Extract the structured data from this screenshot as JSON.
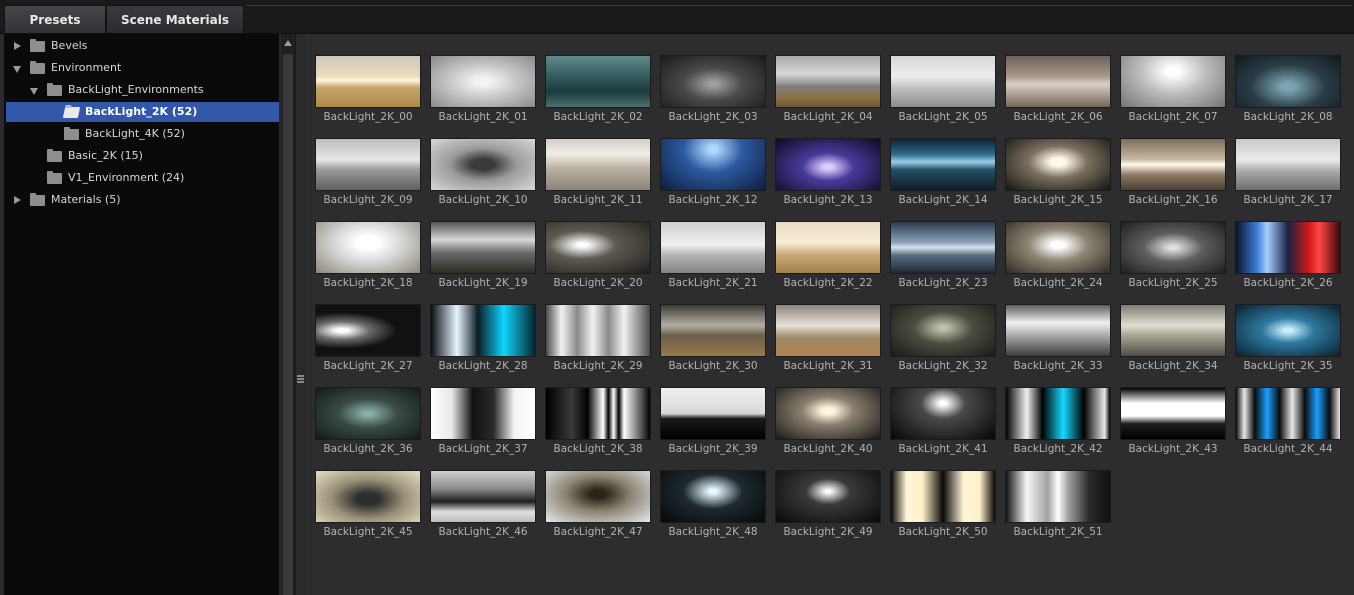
{
  "tabs": [
    {
      "label": "Presets"
    },
    {
      "label": "Scene Materials"
    }
  ],
  "tree": [
    {
      "label": "Bevels",
      "depth": 0,
      "arrow": "right",
      "folder": "closed"
    },
    {
      "label": "Environment",
      "depth": 0,
      "arrow": "down",
      "folder": "closed"
    },
    {
      "label": "BackLight_Environments",
      "depth": 1,
      "arrow": "down",
      "folder": "closed"
    },
    {
      "label": "BackLight_2K (52)",
      "depth": 2,
      "arrow": "",
      "folder": "open",
      "selected": true
    },
    {
      "label": "BackLight_4K (52)",
      "depth": 2,
      "arrow": "",
      "folder": "closed"
    },
    {
      "label": "Basic_2K (15)",
      "depth": 1,
      "arrow": "",
      "folder": "closed"
    },
    {
      "label": "V1_Environment (24)",
      "depth": 1,
      "arrow": "",
      "folder": "closed"
    },
    {
      "label": "Materials (5)",
      "depth": 0,
      "arrow": "right",
      "folder": "closed"
    }
  ],
  "thumbnails": [
    {
      "label": "BackLight_2K_00",
      "bg": "linear-gradient(#cfc6b4 0%, #e9dcc0 40%, #fff6dc 48%, #c9a46a 62%, #b08848 100%)"
    },
    {
      "label": "BackLight_2K_01",
      "bg": "radial-gradient(ellipse at 50% 50%, #f4f4f4 10%, #c8c8c8 45%, #8a8a8a 100%)"
    },
    {
      "label": "BackLight_2K_02",
      "bg": "linear-gradient(#5f8a8c 0%, #2f5557 45%, #1d3a3c 70%, #4b7070 100%)"
    },
    {
      "label": "BackLight_2K_03",
      "bg": "radial-gradient(ellipse at 50% 55%, #a0a0a0 5%, #4a4a4a 40%, #1a1a1a 100%)"
    },
    {
      "label": "BackLight_2K_04",
      "bg": "linear-gradient(#a8a8a8 0%, #d8d8d8 35%, #7d7d7d 60%, #8b7348 80%, #6d5733 100%)"
    },
    {
      "label": "BackLight_2K_05",
      "bg": "linear-gradient(#d6d6d6 0%, #ededed 40%, #bdbdbd 65%, #8c8c8c 100%)"
    },
    {
      "label": "BackLight_2K_06",
      "bg": "linear-gradient(#6e6058 0%, #a89a8a 40%, #d8d0c8 55%, #766659 100%)"
    },
    {
      "label": "BackLight_2K_07",
      "bg": "radial-gradient(ellipse at 50% 30%, #ffffff 8%, #bcbcbc 45%, #747474 100%)"
    },
    {
      "label": "BackLight_2K_08",
      "bg": "radial-gradient(ellipse at 50% 60%, #7da4b5 8%, #2a3e47 50%, #0f1a20 100%)"
    },
    {
      "label": "BackLight_2K_09",
      "bg": "linear-gradient(#bcbcbc 0%, #e8e8e8 40%, #9c9c9c 60%, #5e5e5e 100%)"
    },
    {
      "label": "BackLight_2K_10",
      "bg": "radial-gradient(ellipse at 50% 50%, #3a3a3a 15%, #9a9a9a 45%, #d8d8d8 100%)"
    },
    {
      "label": "BackLight_2K_11",
      "bg": "linear-gradient(#d2cec8 0%, #f2ede4 30%, #b6ada0 60%, #8c8479 100%)"
    },
    {
      "label": "BackLight_2K_12",
      "bg": "radial-gradient(ellipse at 50% 20%, #b0d8ff 5%, #2d5aa0 40%, #0b1d40 100%)"
    },
    {
      "label": "BackLight_2K_13",
      "bg": "radial-gradient(ellipse at 50% 55%, #e0d0ff 5%, #4a3a9a 35%, #0c0a22 100%)"
    },
    {
      "label": "BackLight_2K_14",
      "bg": "linear-gradient(#0e2233 0%, #2e6a8a 30%, #9ad0e8 45%, #274f66 60%, #0d1d2a 100%)"
    },
    {
      "label": "BackLight_2K_15",
      "bg": "radial-gradient(ellipse at 50% 45%, #fff8e8 10%, #7a705e 40%, #141414 100%)"
    },
    {
      "label": "BackLight_2K_16",
      "bg": "linear-gradient(#7c6e5e 0%, #c8b8a0 40%, #fffaf0 50%, #8e7a62 70%, #4c4034 100%)"
    },
    {
      "label": "BackLight_2K_17",
      "bg": "linear-gradient(#c8c8c8 0%, #ececec 40%, #a6a6a6 65%, #6e6e6e 100%)"
    },
    {
      "label": "BackLight_2K_18",
      "bg": "radial-gradient(ellipse at 50% 40%, #ffffff 15%, #d8d8d8 45%, #8a8576 100%)"
    },
    {
      "label": "BackLight_2K_19",
      "bg": "linear-gradient(#555 0%, #d8d8d8 35%, #6a6a6a 60%, #2e2a24 100%)"
    },
    {
      "label": "BackLight_2K_20",
      "bg": "radial-gradient(ellipse at 35% 45%, #ffffff 5%, #5e5a52 35%, #1f1d1a 100%)"
    },
    {
      "label": "BackLight_2K_21",
      "bg": "linear-gradient(#cfcfcf 0%, #f0f0f0 45%, #b5b5b5 65%, #828282 100%)"
    },
    {
      "label": "BackLight_2K_22",
      "bg": "linear-gradient(#e9dcc4 0%, #f8ecd6 40%, #c8a874 65%, #a07e48 100%)"
    },
    {
      "label": "BackLight_2K_23",
      "bg": "linear-gradient(#2c3a4c 0%, #8aa0b8 40%, #d8e4ee 50%, #5a6e82 65%, #1e2834 100%)"
    },
    {
      "label": "BackLight_2K_24",
      "bg": "radial-gradient(ellipse at 50% 45%, #ffffff 8%, #8e8676 40%, #2e2a22 100%)"
    },
    {
      "label": "BackLight_2K_25",
      "bg": "radial-gradient(ellipse at 50% 50%, #e0e0e0 5%, #5e5e5e 40%, #1e1e1e 100%)"
    },
    {
      "label": "BackLight_2K_26",
      "bg": "linear-gradient(90deg, #0c1428 0%, #3c7ad8 20%, #a8d0ff 30%, #1a2244 50%, #d01818 70%, #ff4848 80%, #3c0808 100%)"
    },
    {
      "label": "BackLight_2K_27",
      "bg": "radial-gradient(ellipse at 25% 50%, #ffffff 5%, #6a6a6a 25%, #111 50%)"
    },
    {
      "label": "BackLight_2K_28",
      "bg": "linear-gradient(90deg, #0a0e14 0%, #e8f4ff 25%, #0d1c24 45%, #10d4ff 70%, #04262e 100%)"
    },
    {
      "label": "BackLight_2K_29",
      "bg": "linear-gradient(90deg, #4a4a4a 0%, #f2f2f2 15%, #8a8a8a 30%, #f2f2f2 45%, #8a8a8a 60%, #f2f2f2 75%, #4a4a4a 100%)"
    },
    {
      "label": "BackLight_2K_30",
      "bg": "linear-gradient(#3c3a36 0%, #b4ada2 40%, #6b5e4c 60%, #9a7a4a 100%)"
    },
    {
      "label": "BackLight_2K_31",
      "bg": "linear-gradient(#8a847a 0%, #e8e2d8 40%, #9e8662 65%, #b08450 100%)"
    },
    {
      "label": "BackLight_2K_32",
      "bg": "radial-gradient(ellipse at 50% 45%, #c0c0b0 5%, #4c4c40 40%, #1a1a16 100%)"
    },
    {
      "label": "BackLight_2K_33",
      "bg": "linear-gradient(#5e5e5e 0%, #f0f0f0 35%, #b8b8b8 55%, #3c3c3c 100%)"
    },
    {
      "label": "BackLight_2K_34",
      "bg": "linear-gradient(#7e7c74 0%, #e2dfd2 40%, #a8a496 60%, #504e46 100%)"
    },
    {
      "label": "BackLight_2K_35",
      "bg": "radial-gradient(ellipse at 50% 50%, #c8f0ff 5%, #2e7aa0 35%, #0a1e2c 100%)"
    },
    {
      "label": "BackLight_2K_36",
      "bg": "radial-gradient(ellipse at 50% 50%, #8ab0a8 5%, #3a4c48 40%, #121a18 100%)"
    },
    {
      "label": "BackLight_2K_37",
      "bg": "linear-gradient(90deg, #ffffff 0%, #e8e8e8 20%, #111 40%, #2a2a2a 60%, #f4f4f4 80%, #ffffff 100%)"
    },
    {
      "label": "BackLight_2K_38",
      "bg": "linear-gradient(90deg, #000 0%, #3a3a3a 25%, #000 40%, #fff 55%, #000 60%, #fff 65%, #000 70%, #fff 75%, #000 100%)"
    },
    {
      "label": "BackLight_2K_39",
      "bg": "linear-gradient(#f0f0f0 0%, #d8d8d8 50%, #1a1a1a 60%, #000 100%)"
    },
    {
      "label": "BackLight_2K_40",
      "bg": "radial-gradient(ellipse at 50% 45%, #fff6dc 8%, #8a8070 35%, #1a1816 100%)"
    },
    {
      "label": "BackLight_2K_41",
      "bg": "radial-gradient(ellipse at 50% 30%, #ffffff 4%, #4a4a4a 30%, #050505 100%)"
    },
    {
      "label": "BackLight_2K_42",
      "bg": "linear-gradient(90deg, #000 0%, #f0f0f0 20%, #000 35%, #18d8ff 55%, #000 75%, #e8e8e8 95%, #000 100%)"
    },
    {
      "label": "BackLight_2K_43",
      "bg": "linear-gradient(#000 0%, #ffffff 30%, #ffffff 55%, #1e1e1e 70%, #000 100%)"
    },
    {
      "label": "BackLight_2K_44",
      "bg": "linear-gradient(90deg, #0a0a0a 0%, #e8e8e8 8%, #0a0a0a 18%, #1aa0ff 30%, #0a0a0a 42%, #e8e8e8 54%, #0a0a0a 66%, #1aa0ff 78%, #0a0a0a 90%, #e8e8e8 100%)"
    },
    {
      "label": "BackLight_2K_45",
      "bg": "radial-gradient(ellipse at 50% 55%, #2e2e2e 15%, #9a9278 50%, #e8dec4 100%)"
    },
    {
      "label": "BackLight_2K_46",
      "bg": "linear-gradient(#d0d0d0 0%, #8a8a8a 35%, #1e1e1e 60%, #e0e0e0 80%, #bcbcbc 100%)"
    },
    {
      "label": "BackLight_2K_47",
      "bg": "radial-gradient(ellipse at 50% 45%, #2a2418 10%, #8c8676 45%, #e8e8e8 100%)"
    },
    {
      "label": "BackLight_2K_48",
      "bg": "radial-gradient(ellipse at 50% 40%, #e8f8ff 5%, #1e2a30 40%, #050808 100%)"
    },
    {
      "label": "BackLight_2K_49",
      "bg": "radial-gradient(ellipse at 50% 40%, #ffffff 3%, #3a3a3a 30%, #080808 100%)"
    },
    {
      "label": "BackLight_2K_50",
      "bg": "linear-gradient(90deg, #0a0806 0%, #fff6d8 15%, #fff0c8 30%, #0a0806 50%, #fff6d8 70%, #fff0c8 85%, #0a0806 100%)"
    },
    {
      "label": "BackLight_2K_51",
      "bg": "linear-gradient(90deg, #111 0%, #f8f8f8 20%, #a0a0a0 40%, #ffffff 50%, #a0a0a0 60%, #2a2a2a 80%, #111 100%)"
    }
  ]
}
